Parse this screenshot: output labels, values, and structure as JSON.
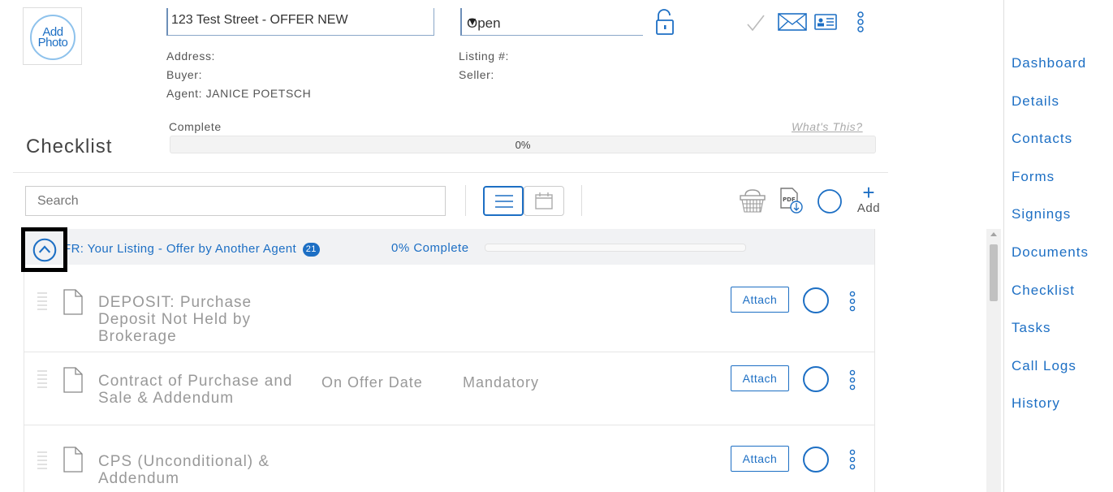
{
  "header": {
    "photo_label_line1": "Add",
    "photo_label_line2": "Photo",
    "title_value": "123 Test Street - OFFER NEW",
    "status_value": "Open",
    "address_label": "Address:",
    "buyer_label": "Buyer:",
    "agent_label": "Agent: JANICE POETSCH",
    "listing_label": "Listing #:",
    "seller_label": "Seller:",
    "icons": [
      "check-icon",
      "mail-icon",
      "contact-card-icon",
      "more-vertical-icon"
    ]
  },
  "progress": {
    "label": "Complete",
    "help_link": "What's This?",
    "value_text": "0%",
    "value": 0
  },
  "checklist": {
    "title": "Checklist",
    "search_placeholder": "Search",
    "add_label": "Add",
    "group": {
      "title": "FR: Your Listing - Offer by Another Agent",
      "count": "21",
      "complete_text": "0% Complete",
      "complete_value": 0
    },
    "rows": [
      {
        "name": "DEPOSIT: Purchase Deposit Not Held by Brokerage",
        "when": "",
        "requirement": "",
        "attach_label": "Attach"
      },
      {
        "name": "Contract of Purchase and Sale & Addendum",
        "when": "On Offer Date",
        "requirement": "Mandatory",
        "attach_label": "Attach"
      },
      {
        "name": "CPS (Unconditional) & Addendum",
        "when": "",
        "requirement": "",
        "attach_label": "Attach"
      }
    ]
  },
  "nav": {
    "items": [
      "Dashboard",
      "Details",
      "Contacts",
      "Forms",
      "Signings",
      "Documents",
      "Checklist",
      "Tasks",
      "Call Logs",
      "History"
    ]
  },
  "colors": {
    "accent": "#1d6fc4",
    "muted_text": "#999999",
    "border": "#e5e5e5"
  }
}
